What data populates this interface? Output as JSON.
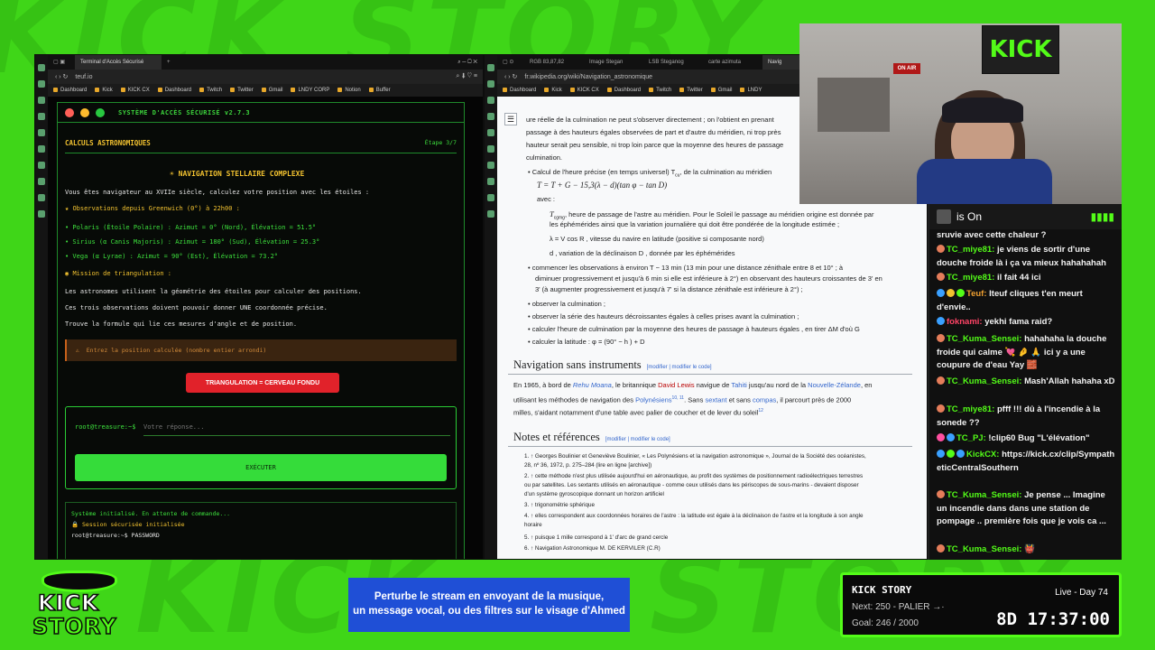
{
  "left_window": {
    "tabs": [
      "Terminal d'Accès Sécurisé"
    ],
    "address": "teuf.io",
    "bookmarks": [
      "Dashboard",
      "Kick",
      "KICK CX",
      "Dashboard",
      "Twitch",
      "Twitter",
      "Gmail",
      "LNDY CORP",
      "Notion",
      "Buffer"
    ],
    "terminal": {
      "title": "SYSTÈME D'ACCÈS SÉCURISÉ v2.7.3",
      "section": "CALCULS ASTRONOMIQUES",
      "step": "Étape 3/7",
      "heading": "NAVIGATION STELLAIRE COMPLEXE",
      "intro": "Vous êtes navigateur au XVIIe siècle, calculez votre position avec les étoiles :",
      "obs_title": "Observations depuis Greenwich (0°) à 22h00 :",
      "obs": [
        "• Polaris (Étoile Polaire) : Azimut = 0° (Nord), Élévation = 51.5°",
        "• Sirius (α Canis Majoris) : Azimut = 180° (Sud), Élévation = 25.3°",
        "• Vega (α Lyrae) : Azimut = 90° (Est), Élévation = 73.2°"
      ],
      "mission_title": "Mission de triangulation :",
      "mission": [
        "Les astronomes utilisent la géométrie des étoiles pour calculer des positions.",
        "Ces trois observations doivent pouvoir donner UNE coordonnée précise.",
        "Trouve la formule qui lie ces mesures d'angle et de position."
      ],
      "warning": "Entrez la position calculée (nombre entier arrondi)",
      "hint_button": "TRIANGULATION = CERVEAU FONDU",
      "prompt": "root@treasure:~$",
      "input_placeholder": "Votre réponse...",
      "exec_label": "EXÉCUTER",
      "log": [
        "Système initialisé. En attente de commande...",
        "Session sécurisée initialisée",
        "root@treasure:~$ PASSWORD"
      ]
    }
  },
  "right_window": {
    "tabs": [
      "RGB 83,87,82",
      "Image Stegan",
      "LSB Steganog",
      "carte azimuta",
      "Navig"
    ],
    "address": "fr.wikipedia.org/wiki/Navigation_astronomique",
    "bookmarks": [
      "Dashboard",
      "Kick",
      "KICK CX",
      "Dashboard",
      "Twitch",
      "Twitter",
      "Gmail",
      "LNDY"
    ],
    "wiki": {
      "top_lines": [
        "ure réelle de la culmination ne peut s'observer directement ; on l'obtient en prenant",
        "passage à des hauteurs égales observées de part et d'autre du méridien, ni trop près",
        "hauteur serait peu sensible, ni trop loin parce que la moyenne des heures de passage",
        "culmination."
      ],
      "bullet1": "Calcul de l'heure précise (en temps universel) T",
      "bullet1_end": ", de la culmination au méridien",
      "formula1": "T = T + G − 15,3(λ − d)(tan φ − tan D)",
      "avec": "avec :",
      "def1": ", heure de passage de l'astre au méridien. Pour le Soleil le passage au méridien origine est donnée par",
      "def1b": "les éphémérides ainsi que la variation journalière qui doit être pondérée de la longitude estimée ;",
      "def2": "λ = V cos R , vitesse du navire en latitude (positive si composante nord)",
      "def3": "d , variation de la déclinaison D , donnée par les éphémérides",
      "b2": "commencer les observations à environ T − 13 min (13 min pour une distance zénithale entre 8 et 10° ; à",
      "b2b": "diminuer progressivement et jusqu'à 6 min si elle est inférieure à 2°) en observant des hauteurs croissantes de 3' en",
      "b2c": "3' (à augmenter progressivement et jusqu'à 7' si la distance zénithale est inférieure à 2°) ;",
      "b3": "observer la culmination ;",
      "b4": "observer la série des hauteurs décroissantes égales à celles prises avant la culmination ;",
      "b5": "calculer l'heure de culmination par la moyenne des heures de passage à hauteurs égales , en tirer ΔM d'où G",
      "b6": "calculer la latitude : φ = (90° − h ) + D",
      "h_nav": "Navigation sans instruments",
      "edit1": "[modifier | modifier le code]",
      "nav1a": "En 1965, à bord de ",
      "nav1_ship": "Rehu Moana",
      "nav1b": ", le britannique ",
      "nav1_person": "David Lewis",
      "nav1c": " navigue de ",
      "nav1_place1": "Tahiti",
      "nav1d": " jusqu'au nord de la ",
      "nav1_place2": "Nouvelle-Zélande",
      "nav1e": ", en",
      "nav2a": "utilisant les méthodes de navigation des ",
      "nav2_link": "Polynésiens",
      "nav2_sup": "10, 11",
      "nav2b": ". Sans ",
      "nav2_l2": "sextant",
      "nav2c": " et sans ",
      "nav2_l3": "compas",
      "nav2d": ", il parcourt près de 2000",
      "nav3": "milles, s'aidant notamment d'une table avec palier de coucher et de lever du soleil",
      "nav3_sup": "12",
      "h_notes": "Notes et références",
      "edit2": "[modifier | modifier le code]",
      "notes": [
        "1. ↑ Georges Boulinier et Geneviève Boulinier, « Les Polynésiens et la navigation astronomique », Journal de la Société des océanistes,",
        "   28, nº 36, 1972, p. 275–284 (lire en ligne [archive])",
        "2. ↑ cette méthode n'est plus utilisée aujourd'hui en aéronautique, au profit des systèmes de positionnement radioélectriques terrestres",
        "   ou par satellites. Les sextants utilisés en aéronautique - comme ceux utilisés dans les périscopes de sous-marins - devaient disposer",
        "   d'un système gyroscopique donnant un horizon artificiel",
        "3. ↑ trigonométrie sphérique",
        "4. ↑ elles correspondent aux coordonnées horaires de l'astre : la latitude est égale à la déclinaison de l'astre et la longitude à son angle",
        "   horaire",
        "5. ↑ puisque 1 mille correspond à 1' d'arc de grand cercle",
        "6. ↑ Navigation Astronomique M. DE KERVILER (C.R)"
      ]
    }
  },
  "cam": {
    "sign": "KICK",
    "onair": "ON AIR"
  },
  "chat": {
    "header": "is On",
    "messages": [
      {
        "user": "",
        "text": "sruvie avec cette chaleur ?"
      },
      {
        "user": "TC_miye81:",
        "text": "je viens de sortir d'une douche froide là i ça va mieux hahahahah"
      },
      {
        "user": "TC_miye81:",
        "text": "il fait 44 ici"
      },
      {
        "user": "Teuf:",
        "text": "Iteuf cliques t'en meurt d'envie.."
      },
      {
        "user": "foknami:",
        "text": "yekhi fama raid?"
      },
      {
        "user": "TC_Kuma_Sensei:",
        "text": "hahahaha la douche froide qui calme 💘 🤌 🙏 ici y a une coupure de d'eau Yay 🧱"
      },
      {
        "user": "TC_Kuma_Sensei:",
        "text": "Mash'Allah hahaha xD"
      },
      {
        "user": "TC_miye81:",
        "text": "pfff !!! dû à l'incendie à la sonede ??"
      },
      {
        "user": "TC_PJ:",
        "text": "!clip60 Bug \"L'élévation\""
      },
      {
        "user": "KickCX:",
        "text": "https://kick.cx/clip/SympatheticCentralSouthern"
      },
      {
        "user": "TC_Kuma_Sensei:",
        "text": "Je pense ... Imagine un incendie dans dans une station de pompage .. première fois que je vois ca ..."
      },
      {
        "user": "TC_Kuma_Sensei:",
        "text": "👹"
      }
    ]
  },
  "logo": {
    "line1": "KICK",
    "line2": "STORY"
  },
  "banner": {
    "line1": "Perturbe le stream en envoyant de la musique,",
    "line2": "un message vocal, ou des filtres sur le visage d'Ahmed"
  },
  "kickstory": {
    "title": "KICK STORY",
    "live": "Live - Day 74",
    "next": "Next: 250 - PALIER →·",
    "goal": "Goal: 246 / 2000",
    "timer": "8D 17:37:00"
  },
  "colors": {
    "background": "#3fd618",
    "kick_green": "#53fc18",
    "banner_blue": "#1f4fd6",
    "terminal_green": "#3de03d",
    "hint_red": "#e1222a"
  }
}
